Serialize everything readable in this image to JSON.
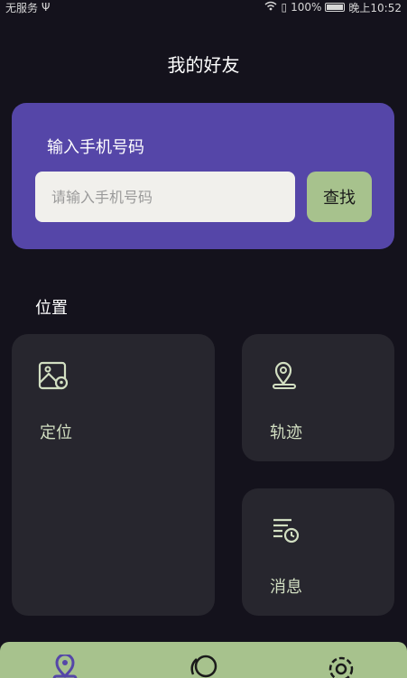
{
  "status_bar": {
    "carrier": "无服务",
    "battery": "100%",
    "time": "晚上10:52"
  },
  "header": {
    "title": "我的好友"
  },
  "search": {
    "label": "输入手机号码",
    "placeholder": "请输入手机号码",
    "button_label": "查找"
  },
  "location_section": {
    "title": "位置",
    "tiles": [
      {
        "label": "定位",
        "icon": "map-pin-icon"
      },
      {
        "label": "轨迹",
        "icon": "location-pin-icon"
      },
      {
        "label": "消息",
        "icon": "message-list-clock-icon"
      }
    ]
  },
  "bottom_nav": {
    "items": [
      {
        "icon": "location-icon"
      },
      {
        "icon": "chat-bubble-icon"
      },
      {
        "icon": "gear-icon"
      }
    ]
  },
  "colors": {
    "background": "#14121c",
    "card_purple": "#5546a8",
    "accent_green": "#a7c28d",
    "tile_bg": "#27262e",
    "tile_text": "#d2dfc2"
  }
}
